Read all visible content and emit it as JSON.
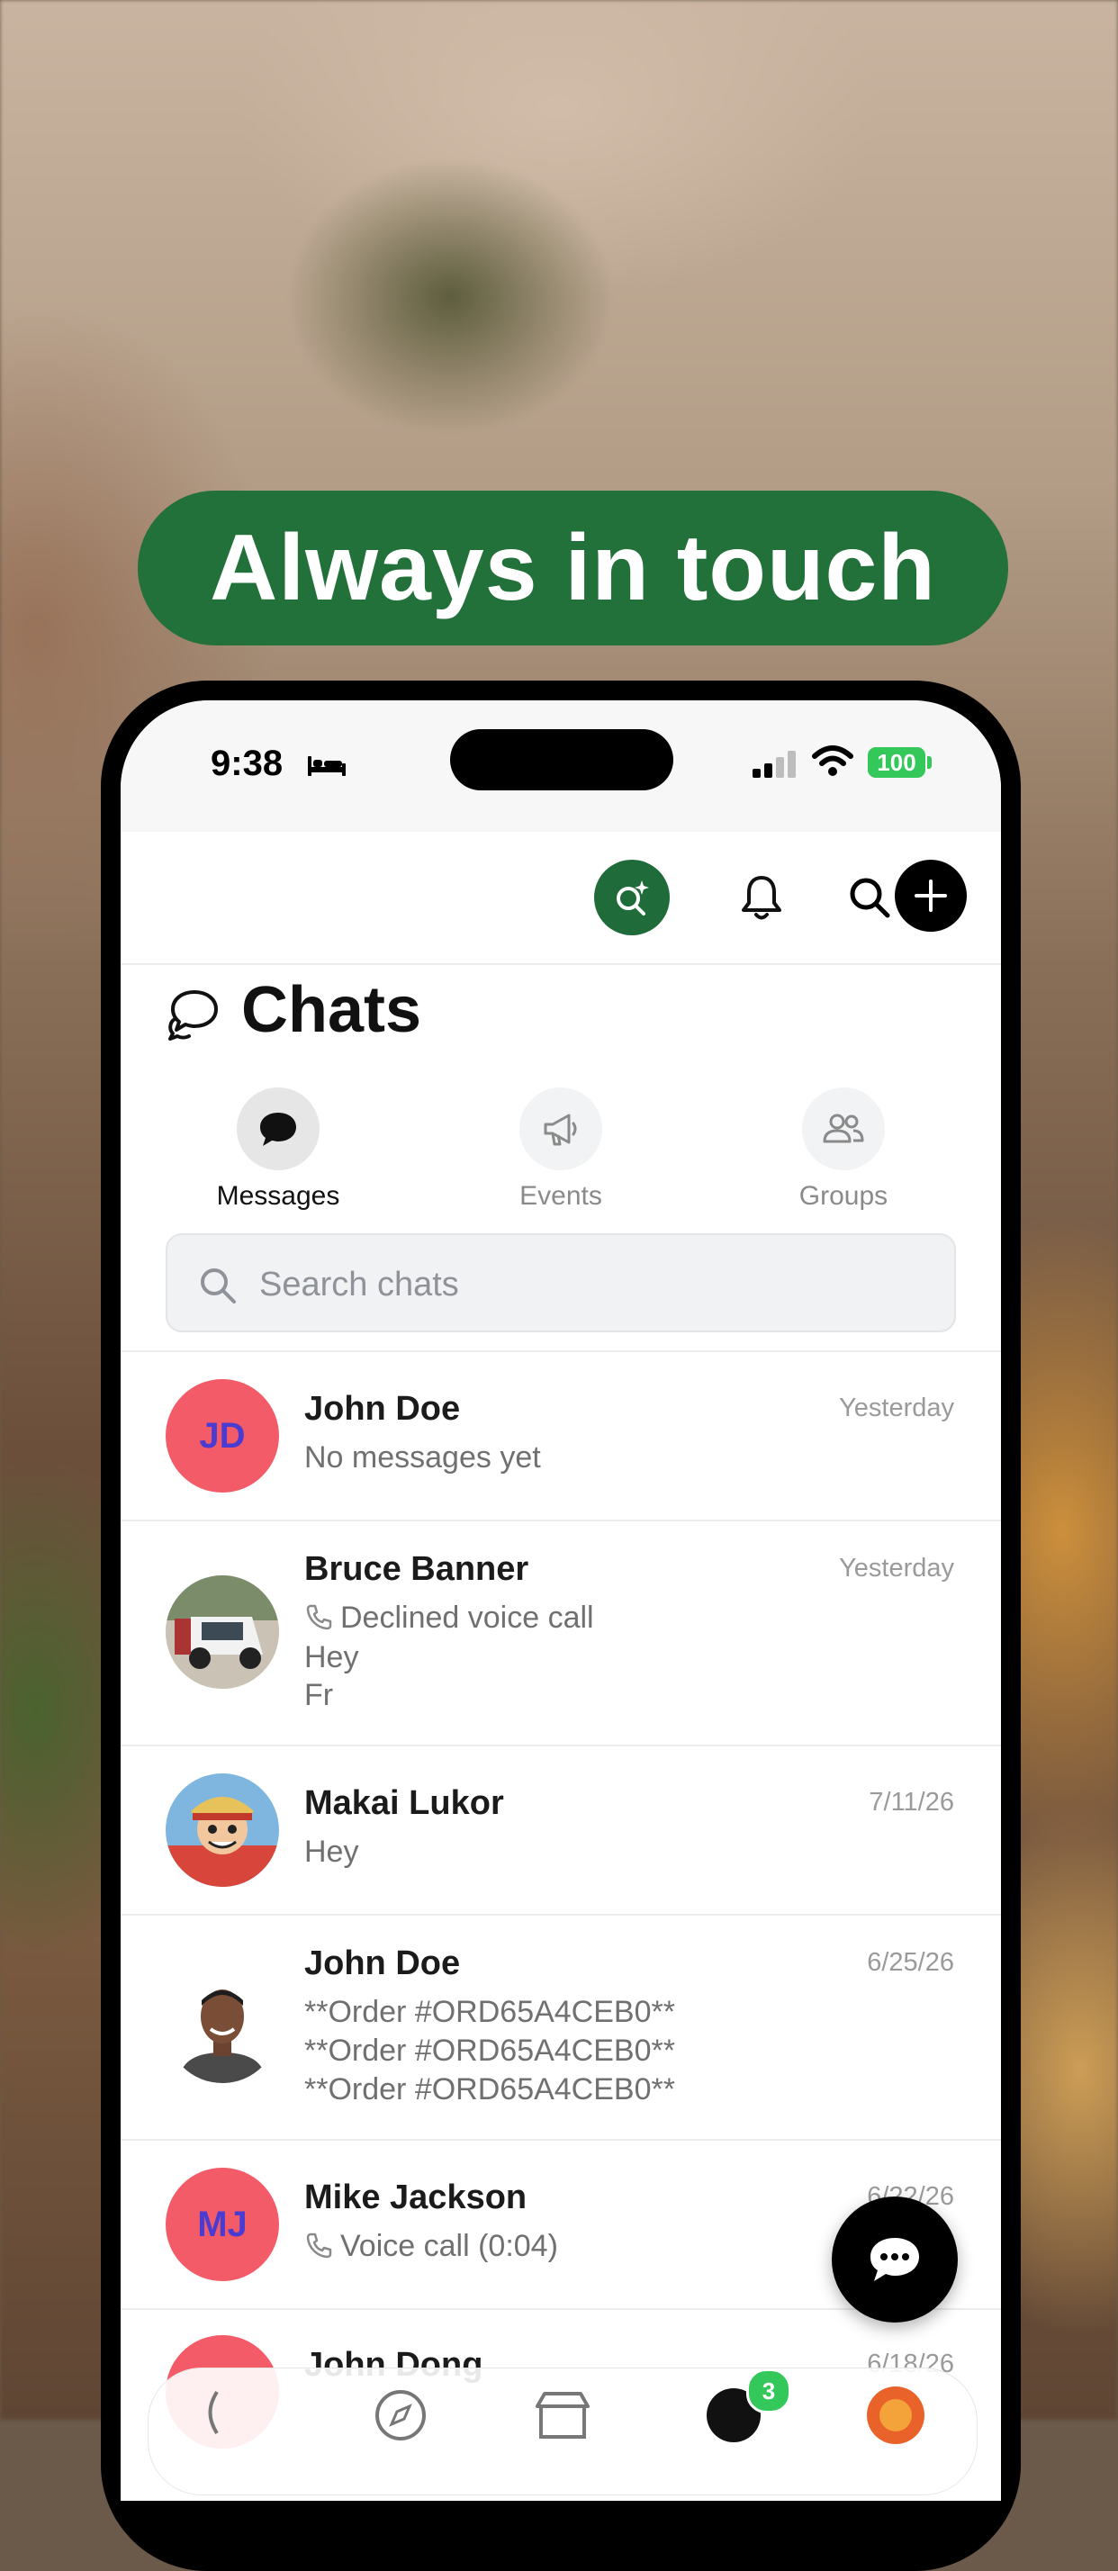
{
  "headline": "Always in touch",
  "status_bar": {
    "time": "9:38",
    "battery": "100"
  },
  "header": {
    "title": "Chats"
  },
  "tabs": [
    {
      "label": "Messages",
      "active": true
    },
    {
      "label": "Events",
      "active": false
    },
    {
      "label": "Groups",
      "active": false
    }
  ],
  "search": {
    "placeholder": "Search chats"
  },
  "chats": [
    {
      "name": "John Doe",
      "date": "Yesterday",
      "initials": "JD",
      "lines": [
        "No messages yet"
      ]
    },
    {
      "name": "Bruce Banner",
      "date": "Yesterday",
      "lines": [
        "Declined voice call",
        "Hey",
        "Fr"
      ]
    },
    {
      "name": "Makai Lukor",
      "date": "7/11/26",
      "lines": [
        "Hey"
      ]
    },
    {
      "name": "John Doe",
      "date": "6/25/26",
      "lines": [
        "**Order #ORD65A4CEB0**",
        "**Order #ORD65A4CEB0**",
        "**Order #ORD65A4CEB0**"
      ]
    },
    {
      "name": "Mike Jackson",
      "date": "6/22/26",
      "initials": "MJ",
      "lines": [
        "Voice call (0:04)"
      ]
    },
    {
      "name": "John Dong",
      "date": "6/18/26"
    }
  ],
  "nav": {
    "chat_badge": "3"
  },
  "colors": {
    "brand_green": "#22703a",
    "avatar_red": "#f45b68",
    "initials_blue": "#4a3bd1",
    "badge_green": "#34c759"
  }
}
